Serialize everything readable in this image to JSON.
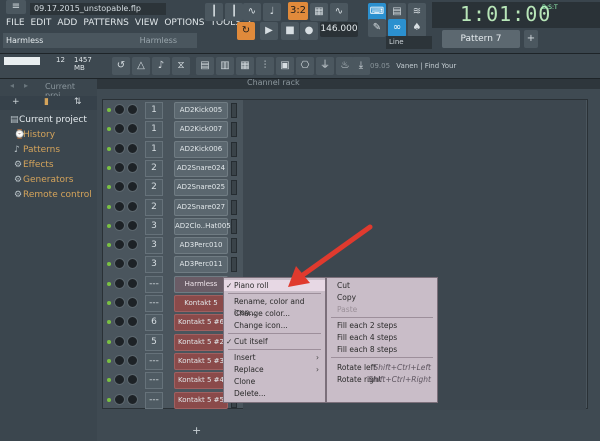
{
  "title_file": "09.17.2015_unstopable.flp",
  "menu": [
    "FILE",
    "EDIT",
    "ADD",
    "PATTERNS",
    "VIEW",
    "OPTIONS",
    "TOOLS",
    "?"
  ],
  "hint": {
    "left": "Harmless",
    "right": "Harmless"
  },
  "transport": {
    "pattern_song": "3:2",
    "tempo": "146.000"
  },
  "time": {
    "value": "1:01:00",
    "label": "B:S:T"
  },
  "pattern_selector": "Pattern 7",
  "snap": "Line",
  "cpu": {
    "value": "12",
    "memory": "1457 MB"
  },
  "news": {
    "date": "09.05",
    "text": "Vanen | Find Your Sound"
  },
  "browser": {
    "header": "Current proj...",
    "items": [
      "Current project",
      "History",
      "Patterns",
      "Effects",
      "Generators",
      "Remote control"
    ]
  },
  "rack": {
    "header": "Channel rack",
    "channels": [
      {
        "num": "1",
        "name": "AD2Kick005"
      },
      {
        "num": "1",
        "name": "AD2Kick007"
      },
      {
        "num": "1",
        "name": "AD2Kick006"
      },
      {
        "num": "2",
        "name": "AD2Snare024"
      },
      {
        "num": "2",
        "name": "AD2Snare025"
      },
      {
        "num": "2",
        "name": "AD2Snare027"
      },
      {
        "num": "3",
        "name": "AD2Clo..Hat005"
      },
      {
        "num": "3",
        "name": "AD3Perc010"
      },
      {
        "num": "3",
        "name": "AD3Perc011"
      },
      {
        "num": "---",
        "name": "Harmless"
      },
      {
        "num": "---",
        "name": "Kontakt 5"
      },
      {
        "num": "6",
        "name": "Kontakt 5 #6"
      },
      {
        "num": "5",
        "name": "Kontakt 5 #2"
      },
      {
        "num": "---",
        "name": "Kontakt 5 #3"
      },
      {
        "num": "---",
        "name": "Kontakt 5 #4"
      },
      {
        "num": "---",
        "name": "Kontakt 5 #5"
      }
    ],
    "add_label": "+"
  },
  "context_menu": {
    "items": [
      "Piano roll",
      "Rename, color and icon...",
      "Change color...",
      "Change icon...",
      "Cut itself",
      "Insert",
      "Replace",
      "Clone",
      "Delete..."
    ]
  },
  "edit_menu": {
    "items": [
      "Cut",
      "Copy",
      "Paste",
      "Fill each 2 steps",
      "Fill each 4 steps",
      "Fill each 8 steps",
      "Rotate left",
      "Rotate right"
    ],
    "shortcuts": {
      "rotate_left": "Shift+Ctrl+Left",
      "rotate_right": "Shift+Ctrl+Right"
    }
  }
}
